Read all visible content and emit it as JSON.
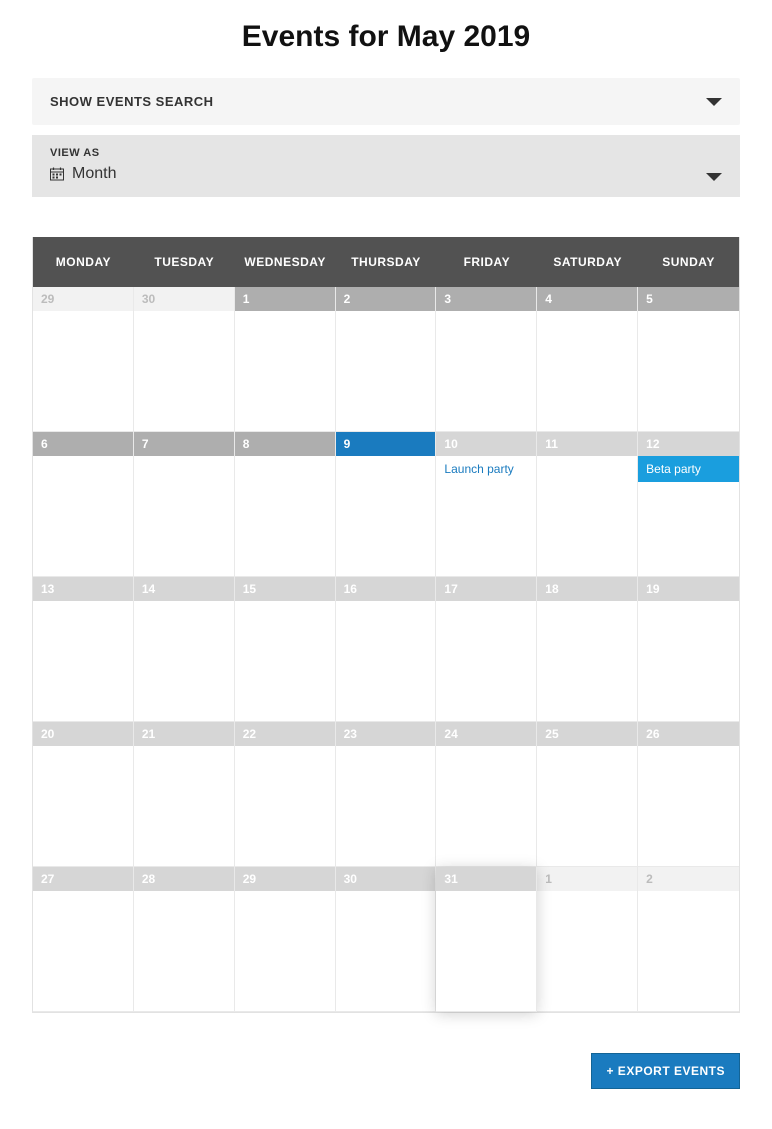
{
  "title": "Events for May 2019",
  "search_toggle_label": "SHOW EVENTS SEARCH",
  "view": {
    "label": "VIEW AS",
    "value": "Month"
  },
  "weekdays": [
    "MONDAY",
    "TUESDAY",
    "WEDNESDAY",
    "THURSDAY",
    "FRIDAY",
    "SATURDAY",
    "SUNDAY"
  ],
  "days": [
    {
      "n": "29",
      "cls": "out-month"
    },
    {
      "n": "30",
      "cls": "out-month"
    },
    {
      "n": "1",
      "cls": "past-bg"
    },
    {
      "n": "2",
      "cls": "past-bg"
    },
    {
      "n": "3",
      "cls": "past-bg"
    },
    {
      "n": "4",
      "cls": "past-bg"
    },
    {
      "n": "5",
      "cls": "past-bg"
    },
    {
      "n": "6",
      "cls": "past-bg"
    },
    {
      "n": "7",
      "cls": "past-bg"
    },
    {
      "n": "8",
      "cls": "past-bg"
    },
    {
      "n": "9",
      "cls": "selected"
    },
    {
      "n": "10",
      "cls": "future-bg",
      "event": {
        "text": "Launch party",
        "style": "link"
      }
    },
    {
      "n": "11",
      "cls": "future-bg"
    },
    {
      "n": "12",
      "cls": "future-bg",
      "event": {
        "text": "Beta party",
        "style": "filled"
      }
    },
    {
      "n": "13",
      "cls": "future-bg"
    },
    {
      "n": "14",
      "cls": "future-bg"
    },
    {
      "n": "15",
      "cls": "future-bg"
    },
    {
      "n": "16",
      "cls": "future-bg"
    },
    {
      "n": "17",
      "cls": "future-bg"
    },
    {
      "n": "18",
      "cls": "future-bg"
    },
    {
      "n": "19",
      "cls": "future-bg"
    },
    {
      "n": "20",
      "cls": "future-bg"
    },
    {
      "n": "21",
      "cls": "future-bg"
    },
    {
      "n": "22",
      "cls": "future-bg"
    },
    {
      "n": "23",
      "cls": "future-bg"
    },
    {
      "n": "24",
      "cls": "future-bg"
    },
    {
      "n": "25",
      "cls": "future-bg"
    },
    {
      "n": "26",
      "cls": "future-bg"
    },
    {
      "n": "27",
      "cls": "future-bg"
    },
    {
      "n": "28",
      "cls": "future-bg"
    },
    {
      "n": "29",
      "cls": "future-bg"
    },
    {
      "n": "30",
      "cls": "future-bg"
    },
    {
      "n": "31",
      "cls": "future-bg",
      "highlight": true
    },
    {
      "n": "1",
      "cls": "out-month"
    },
    {
      "n": "2",
      "cls": "out-month"
    }
  ],
  "export_label": "+ EXPORT EVENTS"
}
